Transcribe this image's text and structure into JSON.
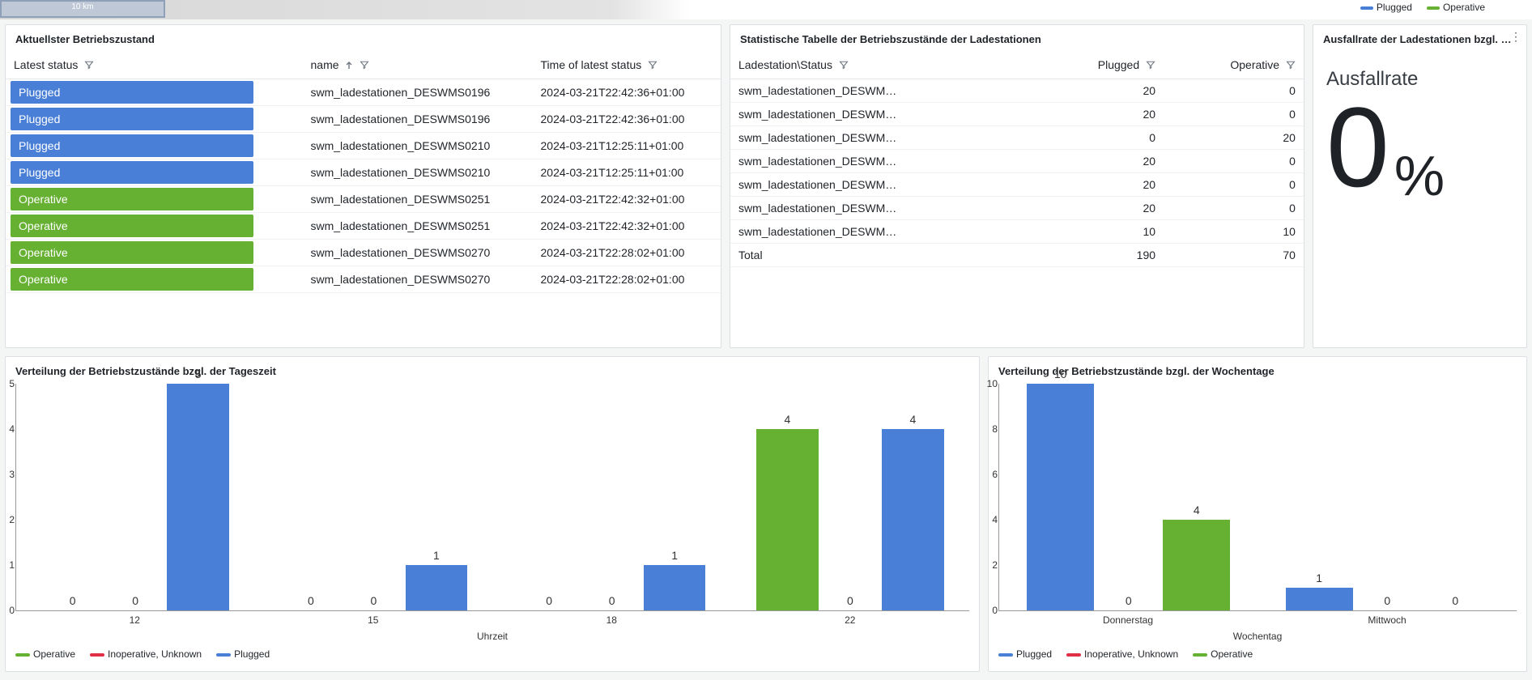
{
  "colors": {
    "plugged": "#4a7fd8",
    "operative": "#66b032",
    "inoperative": "#e02f44"
  },
  "top_legend": [
    {
      "label": "Plugged",
      "color": "#4a7fd8"
    },
    {
      "label": "Operative",
      "color": "#66b032"
    }
  ],
  "scale_label": "10 km",
  "panels": {
    "status": {
      "title": "Aktuellster Betriebszustand",
      "cols": [
        "Latest status",
        "name",
        "Time of latest status"
      ],
      "sort_col": 1
    },
    "stats": {
      "title": "Statistische Tabelle der Betriebszustände der Ladestationen",
      "cols": [
        "Ladestation\\Status",
        "Plugged",
        "Operative"
      ],
      "total_label": "Total"
    },
    "fail": {
      "title": "Ausfallrate der Ladestationen bzgl. b…",
      "label": "Ausfallrate",
      "value": "0",
      "unit": "%"
    },
    "hour": {
      "title": "Verteilung der Betriebstzustände bzgl. der Tageszeit",
      "xlabel": "Uhrzeit"
    },
    "day": {
      "title": "Verteilung der Betriebstzustände bzgl. der Wochentage",
      "xlabel": "Wochentag"
    }
  },
  "status_rows": [
    {
      "status": "Plugged",
      "name": "swm_ladestationen_DESWMS0196",
      "time": "2024-03-21T22:42:36+01:00"
    },
    {
      "status": "Plugged",
      "name": "swm_ladestationen_DESWMS0196",
      "time": "2024-03-21T22:42:36+01:00"
    },
    {
      "status": "Plugged",
      "name": "swm_ladestationen_DESWMS0210",
      "time": "2024-03-21T12:25:11+01:00"
    },
    {
      "status": "Plugged",
      "name": "swm_ladestationen_DESWMS0210",
      "time": "2024-03-21T12:25:11+01:00"
    },
    {
      "status": "Operative",
      "name": "swm_ladestationen_DESWMS0251",
      "time": "2024-03-21T22:42:32+01:00"
    },
    {
      "status": "Operative",
      "name": "swm_ladestationen_DESWMS0251",
      "time": "2024-03-21T22:42:32+01:00"
    },
    {
      "status": "Operative",
      "name": "swm_ladestationen_DESWMS0270",
      "time": "2024-03-21T22:28:02+01:00"
    },
    {
      "status": "Operative",
      "name": "swm_ladestationen_DESWMS0270",
      "time": "2024-03-21T22:28:02+01:00"
    }
  ],
  "stats_rows": [
    {
      "name": "swm_ladestationen_DESWMS…",
      "plugged": 20,
      "operative": 0
    },
    {
      "name": "swm_ladestationen_DESWMS…",
      "plugged": 20,
      "operative": 0
    },
    {
      "name": "swm_ladestationen_DESWMS…",
      "plugged": 0,
      "operative": 20
    },
    {
      "name": "swm_ladestationen_DESWMS…",
      "plugged": 20,
      "operative": 0
    },
    {
      "name": "swm_ladestationen_DESWMS…",
      "plugged": 20,
      "operative": 0
    },
    {
      "name": "swm_ladestationen_DESWMS…",
      "plugged": 20,
      "operative": 0
    },
    {
      "name": "swm_ladestationen_DESWMS…",
      "plugged": 10,
      "operative": 10
    }
  ],
  "stats_total": {
    "plugged": 190,
    "operative": 70
  },
  "chart_data": [
    {
      "id": "hour",
      "type": "bar",
      "categories": [
        "12",
        "15",
        "18",
        "22"
      ],
      "series": [
        {
          "name": "Operative",
          "color": "#66b032",
          "values": [
            0,
            0,
            0,
            4
          ]
        },
        {
          "name": "Inoperative, Unknown",
          "color": "#e02f44",
          "values": [
            0,
            0,
            0,
            0
          ]
        },
        {
          "name": "Plugged",
          "color": "#4a7fd8",
          "values": [
            5,
            1,
            1,
            4
          ]
        }
      ],
      "xlabel": "Uhrzeit",
      "ylabel": "",
      "ylim": [
        0,
        5
      ]
    },
    {
      "id": "day",
      "type": "bar",
      "categories": [
        "Donnerstag",
        "Mittwoch"
      ],
      "series": [
        {
          "name": "Plugged",
          "color": "#4a7fd8",
          "values": [
            10,
            1
          ]
        },
        {
          "name": "Inoperative, Unknown",
          "color": "#e02f44",
          "values": [
            0,
            0
          ]
        },
        {
          "name": "Operative",
          "color": "#66b032",
          "values": [
            4,
            0
          ]
        }
      ],
      "xlabel": "Wochentag",
      "ylabel": "",
      "ylim": [
        0,
        10
      ]
    }
  ],
  "chart_legends": {
    "hour": [
      {
        "label": "Operative",
        "color": "#66b032"
      },
      {
        "label": "Inoperative, Unknown",
        "color": "#e02f44"
      },
      {
        "label": "Plugged",
        "color": "#4a7fd8"
      }
    ],
    "day": [
      {
        "label": "Plugged",
        "color": "#4a7fd8"
      },
      {
        "label": "Inoperative, Unknown",
        "color": "#e02f44"
      },
      {
        "label": "Operative",
        "color": "#66b032"
      }
    ]
  }
}
